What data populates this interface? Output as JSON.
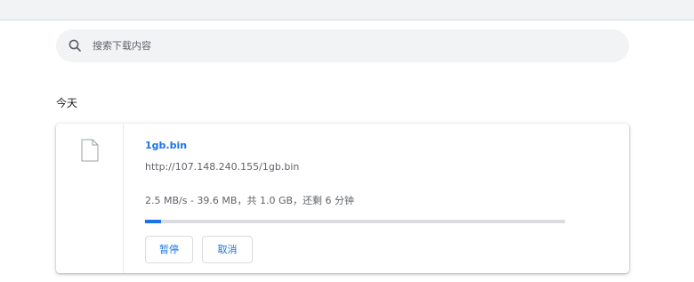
{
  "search": {
    "placeholder": "搜索下载内容",
    "value": ""
  },
  "section": {
    "title": "今天"
  },
  "download": {
    "file_name": "1gb.bin",
    "url": "http://107.148.240.155/1gb.bin",
    "status": "2.5 MB/s - 39.6 MB，共 1.0 GB，还剩 6 分钟",
    "progress_fraction": 0.0387,
    "pause_label": "暂停",
    "cancel_label": "取消"
  },
  "colors": {
    "accent": "#1a73e8",
    "progress_track": "#dadce0",
    "secondary_text": "#5f6368",
    "search_bg": "#f1f3f4"
  },
  "icons": {
    "search": "search-icon",
    "file": "file-icon"
  }
}
